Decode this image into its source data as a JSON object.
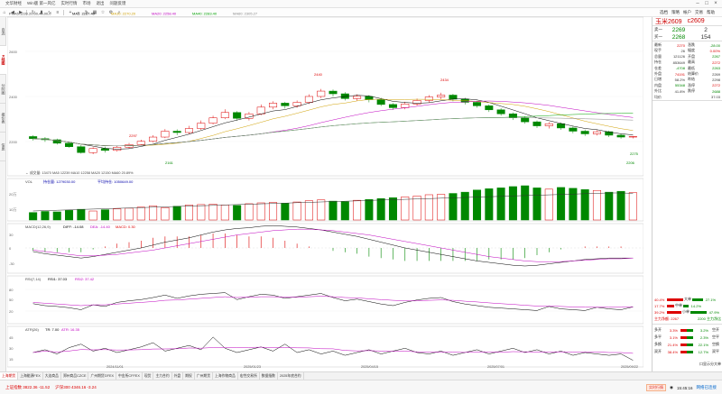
{
  "title_bar": {
    "items": [
      "文华财经",
      "Win版 第一风亿",
      "实时行情",
      "市场",
      "退出",
      "问题反馈"
    ]
  },
  "toolbar": {
    "menu_right": [
      "选档",
      "策略",
      "帐户",
      "交易",
      "帮助"
    ]
  },
  "left_tabs": [
    "自选",
    "K线图",
    "分时图",
    "报价表",
    "信息"
  ],
  "main_chart": {
    "label": "PMA5:1220.20,00,40,00,0",
    "ma_labels": [
      {
        "text": "MA5: 2267.40",
        "color": "#000000"
      },
      {
        "text": "MA10: 2270.20",
        "color": "#d0a000"
      },
      {
        "text": "MA20: 2258.40",
        "color": "#c000c0"
      },
      {
        "text": "MA40: 2283.40",
        "color": "#00a000"
      },
      {
        "text": "MA60: 2305.27",
        "color": "#888888"
      }
    ],
    "price_ticks": [
      "2600",
      "2400",
      "2200"
    ],
    "annotations": [
      "2440",
      "2434",
      "2297",
      "2275",
      "2206",
      "2161"
    ],
    "sub_label": "← 成交量: 13470 MA5 12239 MA10 12258 MA20 12150 MA60 20.89%"
  },
  "volume_panel": {
    "label": "VOL",
    "values": [
      "持仓量: 1279030.00",
      "平均持仓: 1050649.00"
    ],
    "ticks": [
      "20万",
      "10万"
    ]
  },
  "macd_panel": {
    "label": "MACD(12,26,9)",
    "values": [
      "DIFF: -14.08",
      "DEA: -14.40",
      "MACD: 0.30"
    ],
    "ticks": [
      "30",
      "0",
      "-30"
    ]
  },
  "rsi_panel": {
    "label": "RSI(7,14)",
    "values": [
      "RSI1: 37.03",
      "RSI2: 37.42"
    ],
    "ticks": [
      "80",
      "50",
      "20"
    ]
  },
  "atr_panel": {
    "label": "ATR(26)",
    "values": [
      "TR: 7.00",
      "ATR: 16.35"
    ],
    "ticks": [
      "45",
      "30",
      "15"
    ]
  },
  "dates": [
    "2024/11/01",
    "2025/01/23",
    "2025/04/15",
    "2025/07/01",
    "2025/09/22"
  ],
  "quote_panel": {
    "name": "玉米2609",
    "code": "c2609",
    "ask_label": "卖一",
    "ask_price": "2269",
    "ask_volume": "2",
    "bid_label": "买一",
    "bid_price": "2268",
    "bid_volume": "154",
    "rows": [
      {
        "l1": "最新",
        "v1": "2270",
        "c1": "red",
        "l2": "涨跌",
        "v2": "-28.00",
        "c2": "green"
      },
      {
        "l1": "现手",
        "v1": "26",
        "c1": "dark",
        "l2": "幅度",
        "v2": "0.00%",
        "c2": "red"
      },
      {
        "l1": "总量",
        "v1": "121126",
        "c1": "dark",
        "l2": "开盘",
        "v2": "2267",
        "c2": "green"
      },
      {
        "l1": "持仓",
        "v1": "853649",
        "c1": "dark",
        "l2": "最高",
        "v2": "2272",
        "c2": "red"
      },
      {
        "l1": "仓差",
        "v1": "-4708",
        "c1": "green",
        "l2": "最低",
        "v2": "2263",
        "c2": "green"
      },
      {
        "l1": "外盘",
        "v1": "74191",
        "c1": "red",
        "l2": "结算价",
        "v2": "2269",
        "c2": "dark"
      },
      {
        "l1": "日增",
        "v1": "58.2%",
        "c1": "dark",
        "l2": "昨结",
        "v2": "2298",
        "c2": "dark"
      },
      {
        "l1": "内盘",
        "v1": "55348",
        "c1": "green",
        "l2": "涨停",
        "v2": "2272",
        "c2": "red"
      },
      {
        "l1": "外比",
        "v1": "41.8%",
        "c1": "dark",
        "l2": "跌停",
        "v2": "2688",
        "c2": "green"
      },
      {
        "l1": "均价",
        "v1": "",
        "c1": "dark",
        "l2": "",
        "v2": "37.03",
        "c2": "dark"
      }
    ],
    "flow": [
      {
        "left": "40.4%",
        "mid": "大单",
        "right": "27.1%"
      },
      {
        "left": "17.7%",
        "mid": "中单",
        "right": "14.2%"
      },
      {
        "left": "39.2%",
        "mid": "小单",
        "right": "47.9%"
      }
    ],
    "flow_foot": [
      "主力净额: 2267",
      "2200 主力净比"
    ],
    "stats": [
      {
        "a": "多开",
        "av": "3.3%",
        "b": "空开",
        "bv": "3.2%"
      },
      {
        "a": "多平",
        "av": "3.1%",
        "b": "空平",
        "bv": "2.3%"
      },
      {
        "a": "多换",
        "av": "21.4%",
        "b": "空换",
        "bv": "22.1%"
      },
      {
        "a": "双开",
        "av": "38.4%",
        "b": "双平",
        "bv": "12.7%"
      }
    ],
    "footer": "口显示分大单"
  },
  "bottom_tabs": [
    "上海期货",
    "上海能源FEX",
    "大连商品",
    "郑州商品CZCE",
    "广州期货GFEX",
    "中金所CFFEX",
    "现货",
    "主力合约",
    "外盘",
    "期权",
    "广州期货",
    "上海作物商品",
    "宏性交易所",
    "数据指数",
    "2025年底合约"
  ],
  "status": {
    "items": [
      {
        "text": "上证指数 3822.36 -11.52",
        "color": "#d00"
      },
      {
        "text": "沪深300 4346.16 -3.24",
        "color": "#d00"
      }
    ],
    "badge": "实时行情",
    "time": "15:45:16",
    "link": "网络已连接"
  },
  "chart_data": {
    "type": "candlestick",
    "title": "",
    "ylim": [
      2150,
      2700
    ],
    "candles": [
      [
        2270,
        2262,
        2275,
        2255
      ],
      [
        2262,
        2258,
        2268,
        2250
      ],
      [
        2258,
        2245,
        2262,
        2240
      ],
      [
        2245,
        2232,
        2250,
        2228
      ],
      [
        2232,
        2210,
        2238,
        2206
      ],
      [
        2210,
        2225,
        2230,
        2204
      ],
      [
        2225,
        2218,
        2232,
        2210
      ],
      [
        2218,
        2230,
        2236,
        2214
      ],
      [
        2230,
        2240,
        2246,
        2226
      ],
      [
        2240,
        2252,
        2258,
        2236
      ],
      [
        2252,
        2268,
        2275,
        2248
      ],
      [
        2268,
        2290,
        2298,
        2264
      ],
      [
        2290,
        2285,
        2297,
        2275
      ],
      [
        2285,
        2300,
        2310,
        2280
      ],
      [
        2300,
        2320,
        2330,
        2295
      ],
      [
        2320,
        2340,
        2348,
        2315
      ],
      [
        2340,
        2360,
        2372,
        2335
      ],
      [
        2360,
        2338,
        2365,
        2330
      ],
      [
        2338,
        2355,
        2362,
        2330
      ],
      [
        2355,
        2380,
        2390,
        2350
      ],
      [
        2380,
        2395,
        2402,
        2372
      ],
      [
        2395,
        2385,
        2400,
        2375
      ],
      [
        2385,
        2398,
        2405,
        2378
      ],
      [
        2398,
        2420,
        2428,
        2392
      ],
      [
        2420,
        2440,
        2448,
        2414
      ],
      [
        2440,
        2430,
        2446,
        2420
      ],
      [
        2430,
        2412,
        2436,
        2405
      ],
      [
        2412,
        2420,
        2428,
        2404
      ],
      [
        2420,
        2408,
        2425,
        2398
      ],
      [
        2408,
        2390,
        2415,
        2384
      ],
      [
        2390,
        2378,
        2395,
        2370
      ],
      [
        2378,
        2392,
        2400,
        2372
      ],
      [
        2392,
        2405,
        2412,
        2386
      ],
      [
        2405,
        2418,
        2425,
        2398
      ],
      [
        2418,
        2425,
        2434,
        2410
      ],
      [
        2425,
        2410,
        2430,
        2402
      ],
      [
        2410,
        2398,
        2415,
        2390
      ],
      [
        2398,
        2385,
        2404,
        2378
      ],
      [
        2385,
        2370,
        2390,
        2362
      ],
      [
        2370,
        2355,
        2376,
        2348
      ],
      [
        2355,
        2340,
        2360,
        2332
      ],
      [
        2340,
        2325,
        2346,
        2318
      ],
      [
        2325,
        2310,
        2330,
        2302
      ],
      [
        2310,
        2318,
        2324,
        2300
      ],
      [
        2318,
        2302,
        2322,
        2295
      ],
      [
        2302,
        2290,
        2308,
        2282
      ],
      [
        2290,
        2280,
        2296,
        2272
      ],
      [
        2280,
        2288,
        2294,
        2274
      ],
      [
        2288,
        2275,
        2292,
        2268
      ],
      [
        2275,
        2268,
        2280,
        2262
      ],
      [
        2268,
        2270,
        2272,
        2263
      ]
    ],
    "volume": [
      35,
      40,
      38,
      45,
      50,
      42,
      48,
      52,
      55,
      60,
      66,
      58,
      64,
      70,
      72,
      74,
      70,
      68,
      76,
      80,
      82,
      78,
      84,
      90,
      94,
      88,
      86,
      92,
      96,
      100,
      104,
      108,
      112,
      118,
      120,
      124,
      130,
      140,
      146,
      150,
      156,
      160,
      150,
      144,
      152,
      148,
      142,
      138,
      130,
      134,
      128
    ],
    "oi": [
      98,
      99,
      100,
      101,
      102,
      103,
      104,
      105,
      106,
      107,
      108,
      109,
      110,
      111,
      112,
      113,
      114,
      115,
      116,
      117,
      118,
      119,
      120,
      121,
      122,
      123,
      124,
      125,
      126,
      127,
      128,
      129,
      130,
      131,
      132,
      133,
      134,
      135,
      136,
      137,
      138,
      139,
      140,
      141,
      142,
      143,
      144,
      145,
      146,
      146,
      145
    ],
    "macd_diff": [
      -5,
      -8,
      -10,
      -12,
      -14,
      -12,
      -9,
      -6,
      -3,
      0,
      4,
      8,
      11,
      14,
      18,
      22,
      25,
      27,
      28,
      30,
      31,
      30,
      29,
      27,
      25,
      22,
      19,
      16,
      12,
      8,
      4,
      0,
      -3,
      -6,
      -9,
      -12,
      -15,
      -18,
      -20,
      -22,
      -24,
      -25,
      -24,
      -22,
      -20,
      -18,
      -16,
      -15,
      -14,
      -14,
      -14
    ],
    "macd_dea": [
      -3,
      -5,
      -7,
      -9,
      -11,
      -11,
      -10,
      -9,
      -7,
      -5,
      -3,
      0,
      3,
      6,
      9,
      12,
      15,
      18,
      20,
      22,
      24,
      25,
      26,
      26,
      25,
      24,
      22,
      20,
      18,
      15,
      12,
      9,
      6,
      3,
      0,
      -3,
      -6,
      -9,
      -12,
      -14,
      -16,
      -18,
      -19,
      -19,
      -19,
      -18,
      -17,
      -16,
      -15,
      -15,
      -14
    ],
    "rsi1": [
      45,
      40,
      38,
      35,
      30,
      42,
      38,
      48,
      52,
      55,
      60,
      66,
      58,
      64,
      68,
      70,
      72,
      55,
      62,
      68,
      66,
      58,
      62,
      66,
      70,
      60,
      52,
      56,
      50,
      44,
      40,
      48,
      54,
      58,
      60,
      50,
      44,
      40,
      36,
      34,
      32,
      30,
      28,
      38,
      32,
      30,
      28,
      36,
      32,
      30,
      37
    ],
    "rsi2": [
      48,
      46,
      44,
      42,
      40,
      42,
      42,
      44,
      46,
      48,
      50,
      53,
      54,
      56,
      58,
      60,
      62,
      60,
      61,
      62,
      62,
      61,
      61,
      62,
      63,
      62,
      60,
      59,
      57,
      55,
      53,
      52,
      52,
      53,
      54,
      53,
      51,
      49,
      47,
      45,
      43,
      41,
      39,
      39,
      38,
      37,
      36,
      36,
      36,
      36,
      37
    ],
    "atr": [
      18,
      22,
      16,
      25,
      30,
      20,
      24,
      18,
      22,
      26,
      32,
      20,
      24,
      28,
      22,
      40,
      24,
      18,
      22,
      26,
      20,
      30,
      18,
      22,
      16,
      20,
      14,
      18,
      22,
      16,
      20,
      24,
      18,
      16,
      20,
      14,
      18,
      22,
      16,
      20,
      24,
      18,
      22,
      16,
      20,
      14,
      18,
      16,
      14,
      16,
      7
    ]
  }
}
